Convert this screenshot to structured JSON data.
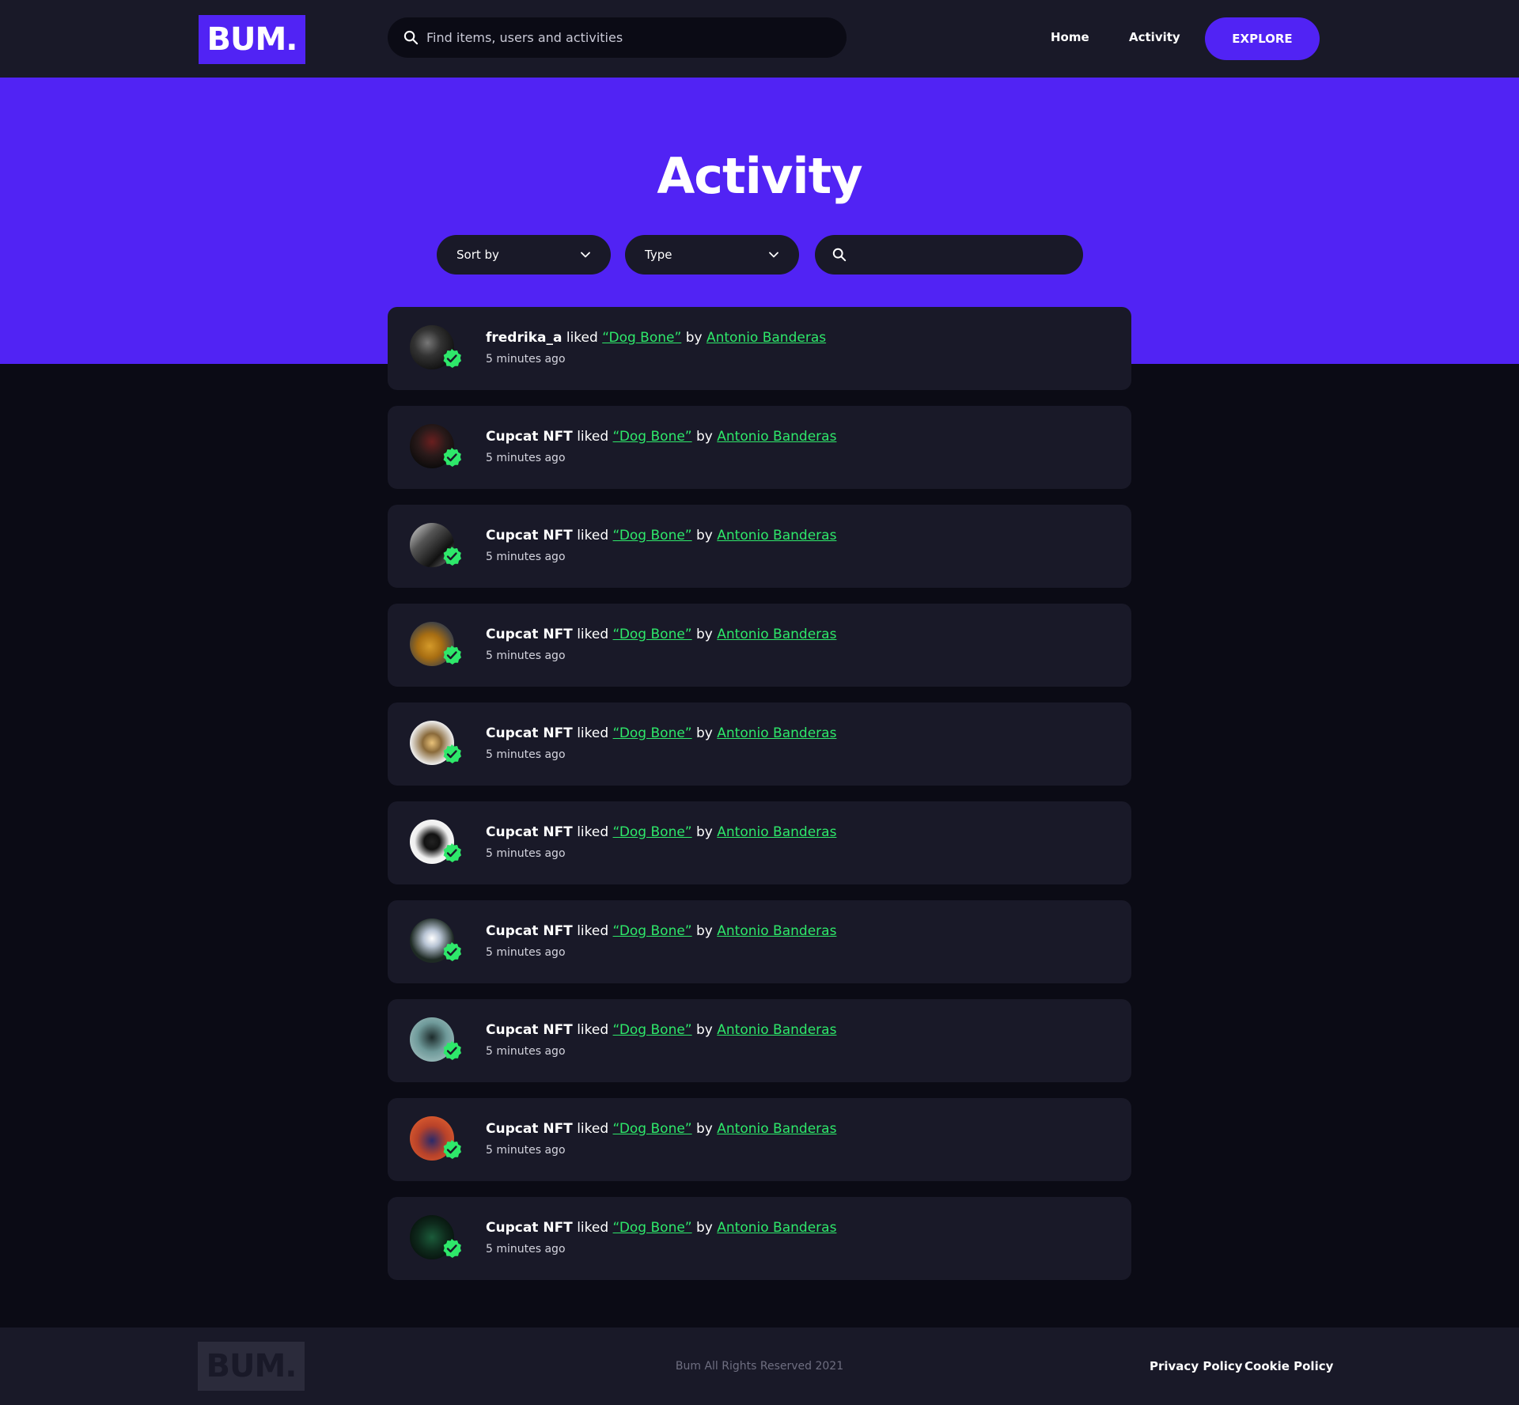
{
  "header": {
    "logo": "BUM.",
    "search_placeholder": "Find items, users and activities",
    "nav": {
      "home": "Home",
      "activity": "Activity"
    },
    "explore_label": "EXPLORE"
  },
  "hero": {
    "title": "Activity",
    "sort_label": "Sort by",
    "type_label": "Type",
    "search_value": ""
  },
  "colors": {
    "brand": "#5123f4",
    "card": "#191928",
    "link": "#2ee86a",
    "verified": "#2ee86a"
  },
  "feed": [
    {
      "user": "fredrika_a",
      "verb": "liked",
      "item": "“Dog Bone”",
      "by": "by",
      "artist": "Antonio Banderas",
      "time": "5 minutes ago",
      "avatar": "dark-helmet"
    },
    {
      "user": "Cupcat NFT",
      "verb": "liked",
      "item": "“Dog Bone”",
      "by": "by",
      "artist": "Antonio Banderas",
      "time": "5 minutes ago",
      "avatar": "dark-sphere"
    },
    {
      "user": "Cupcat NFT",
      "verb": "liked",
      "item": "“Dog Bone”",
      "by": "by",
      "artist": "Antonio Banderas",
      "time": "5 minutes ago",
      "avatar": "robot"
    },
    {
      "user": "Cupcat NFT",
      "verb": "liked",
      "item": "“Dog Bone”",
      "by": "by",
      "artist": "Antonio Banderas",
      "time": "5 minutes ago",
      "avatar": "gold-figure"
    },
    {
      "user": "Cupcat NFT",
      "verb": "liked",
      "item": "“Dog Bone”",
      "by": "by",
      "artist": "Antonio Banderas",
      "time": "5 minutes ago",
      "avatar": "gold-flower"
    },
    {
      "user": "Cupcat NFT",
      "verb": "liked",
      "item": "“Dog Bone”",
      "by": "by",
      "artist": "Antonio Banderas",
      "time": "5 minutes ago",
      "avatar": "chalice"
    },
    {
      "user": "Cupcat NFT",
      "verb": "liked",
      "item": "“Dog Bone”",
      "by": "by",
      "artist": "Antonio Banderas",
      "time": "5 minutes ago",
      "avatar": "astronaut"
    },
    {
      "user": "Cupcat NFT",
      "verb": "liked",
      "item": "“Dog Bone”",
      "by": "by",
      "artist": "Antonio Banderas",
      "time": "5 minutes ago",
      "avatar": "teal-figure"
    },
    {
      "user": "Cupcat NFT",
      "verb": "liked",
      "item": "“Dog Bone”",
      "by": "by",
      "artist": "Antonio Banderas",
      "time": "5 minutes ago",
      "avatar": "red-tower"
    },
    {
      "user": "Cupcat NFT",
      "verb": "liked",
      "item": "“Dog Bone”",
      "by": "by",
      "artist": "Antonio Banderas",
      "time": "5 minutes ago",
      "avatar": "green-chip"
    }
  ],
  "footer": {
    "logo": "BUM.",
    "copyright": "Bum All Rights Reserved 2021",
    "privacy": "Privacy Policy",
    "cookie": "Cookie Policy"
  }
}
